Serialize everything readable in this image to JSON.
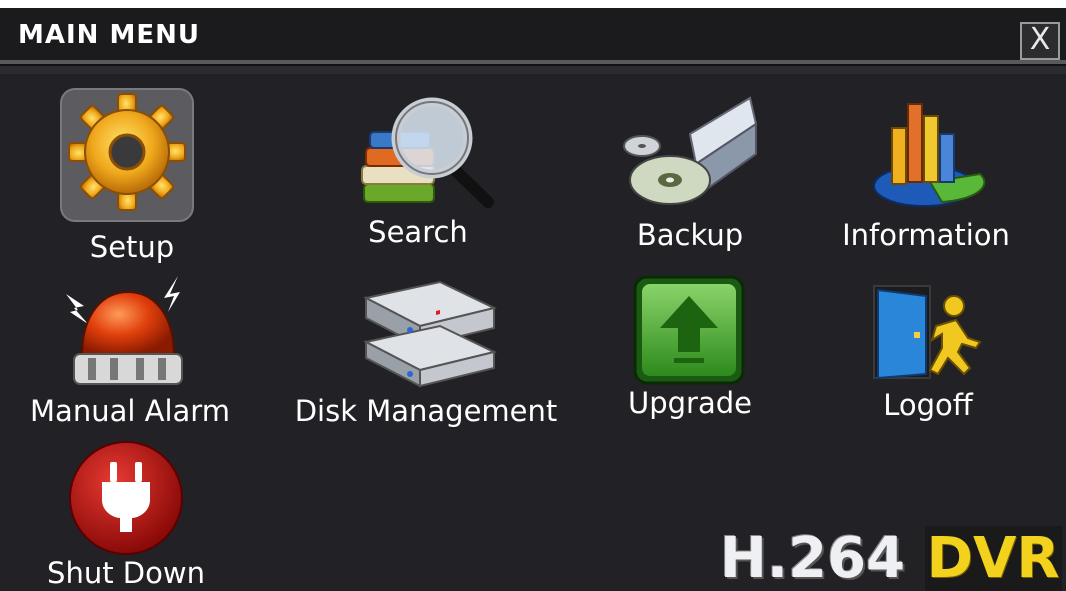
{
  "window": {
    "title": "MAIN MENU",
    "close_symbol": "X"
  },
  "menu_items": [
    {
      "label": "Setup",
      "icon": "gear-icon",
      "selected": true
    },
    {
      "label": "Search",
      "icon": "magnifier-books-icon"
    },
    {
      "label": "Backup",
      "icon": "disc-drive-icon"
    },
    {
      "label": "Information",
      "icon": "bar-pie-chart-icon"
    },
    {
      "label": "Manual Alarm",
      "icon": "alarm-siren-icon"
    },
    {
      "label": "Disk Management",
      "icon": "hard-disks-icon"
    },
    {
      "label": "Upgrade",
      "icon": "upload-arrow-icon"
    },
    {
      "label": "Logoff",
      "icon": "exit-door-icon"
    },
    {
      "label": "Shut Down",
      "icon": "power-plug-icon"
    }
  ],
  "brand": {
    "codec": "H.264",
    "product": "DVR"
  },
  "colors": {
    "background": "#222226",
    "titlebar": "#1b1b1d",
    "text": "#ffffff",
    "brand_yellow": "#f2d21c"
  }
}
